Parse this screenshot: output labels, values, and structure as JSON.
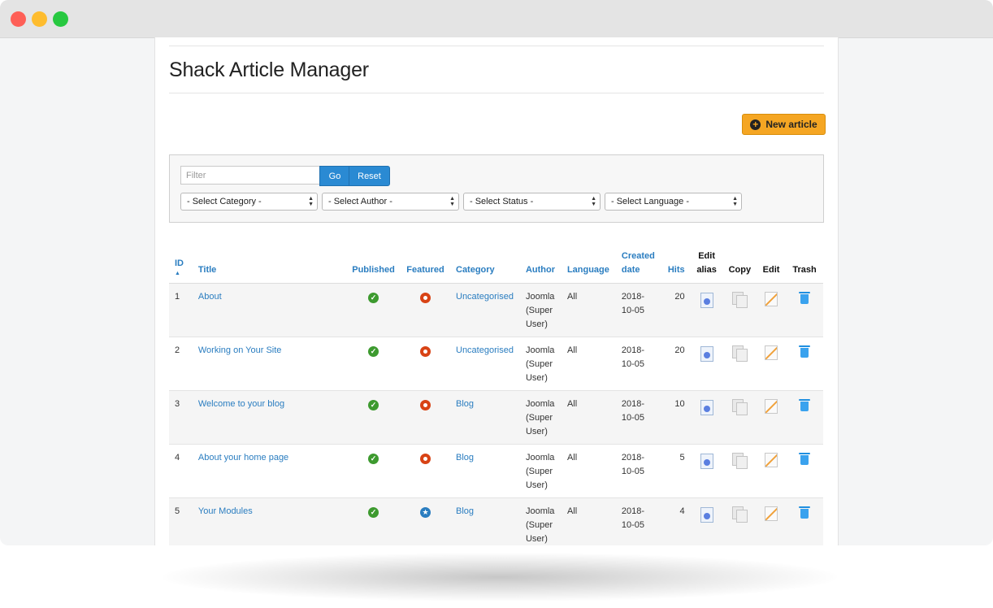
{
  "page": {
    "title": "Shack Article Manager",
    "new_button_label": "New article"
  },
  "filters": {
    "filter_placeholder": "Filter",
    "go_label": "Go",
    "reset_label": "Reset",
    "selects": [
      "- Select Category -",
      "- Select Author -",
      "- Select Status -",
      "- Select Language -"
    ]
  },
  "table": {
    "headers": {
      "id": "ID",
      "title": "Title",
      "published": "Published",
      "featured": "Featured",
      "category": "Category",
      "author": "Author",
      "language": "Language",
      "created_date": "Created date",
      "hits": "Hits",
      "edit_alias": "Edit alias",
      "copy": "Copy",
      "edit": "Edit",
      "trash": "Trash"
    },
    "rows": [
      {
        "id": "1",
        "title": "About",
        "published": true,
        "featured": false,
        "category": "Uncategorised",
        "author": "Joomla (Super User)",
        "language": "All",
        "created": "2018-10-05",
        "hits": "20"
      },
      {
        "id": "2",
        "title": "Working on Your Site",
        "published": true,
        "featured": false,
        "category": "Uncategorised",
        "author": "Joomla (Super User)",
        "language": "All",
        "created": "2018-10-05",
        "hits": "20"
      },
      {
        "id": "3",
        "title": "Welcome to your blog",
        "published": true,
        "featured": false,
        "category": "Blog",
        "author": "Joomla (Super User)",
        "language": "All",
        "created": "2018-10-05",
        "hits": "10"
      },
      {
        "id": "4",
        "title": "About your home page",
        "published": true,
        "featured": false,
        "category": "Blog",
        "author": "Joomla (Super User)",
        "language": "All",
        "created": "2018-10-05",
        "hits": "5"
      },
      {
        "id": "5",
        "title": "Your Modules",
        "published": true,
        "featured": true,
        "category": "Blog",
        "author": "Joomla (Super User)",
        "language": "All",
        "created": "2018-10-05",
        "hits": "4"
      }
    ]
  },
  "colors": {
    "link": "#2a7dc0",
    "primary_button": "#2a8ad3",
    "new_button": "#f5a623",
    "published": "#3d9a2f",
    "unfeatured": "#d84315"
  },
  "icons": {
    "new_button": "plus-circle-icon",
    "sort": "sort-ascending-icon",
    "published": "check-circle-icon",
    "unfeatured": "unfeatured-circle-icon",
    "featured": "star-circle-icon",
    "edit_alias": "edit-alias-icon",
    "copy": "copy-icon",
    "edit": "edit-pencil-icon",
    "trash": "trash-icon"
  }
}
